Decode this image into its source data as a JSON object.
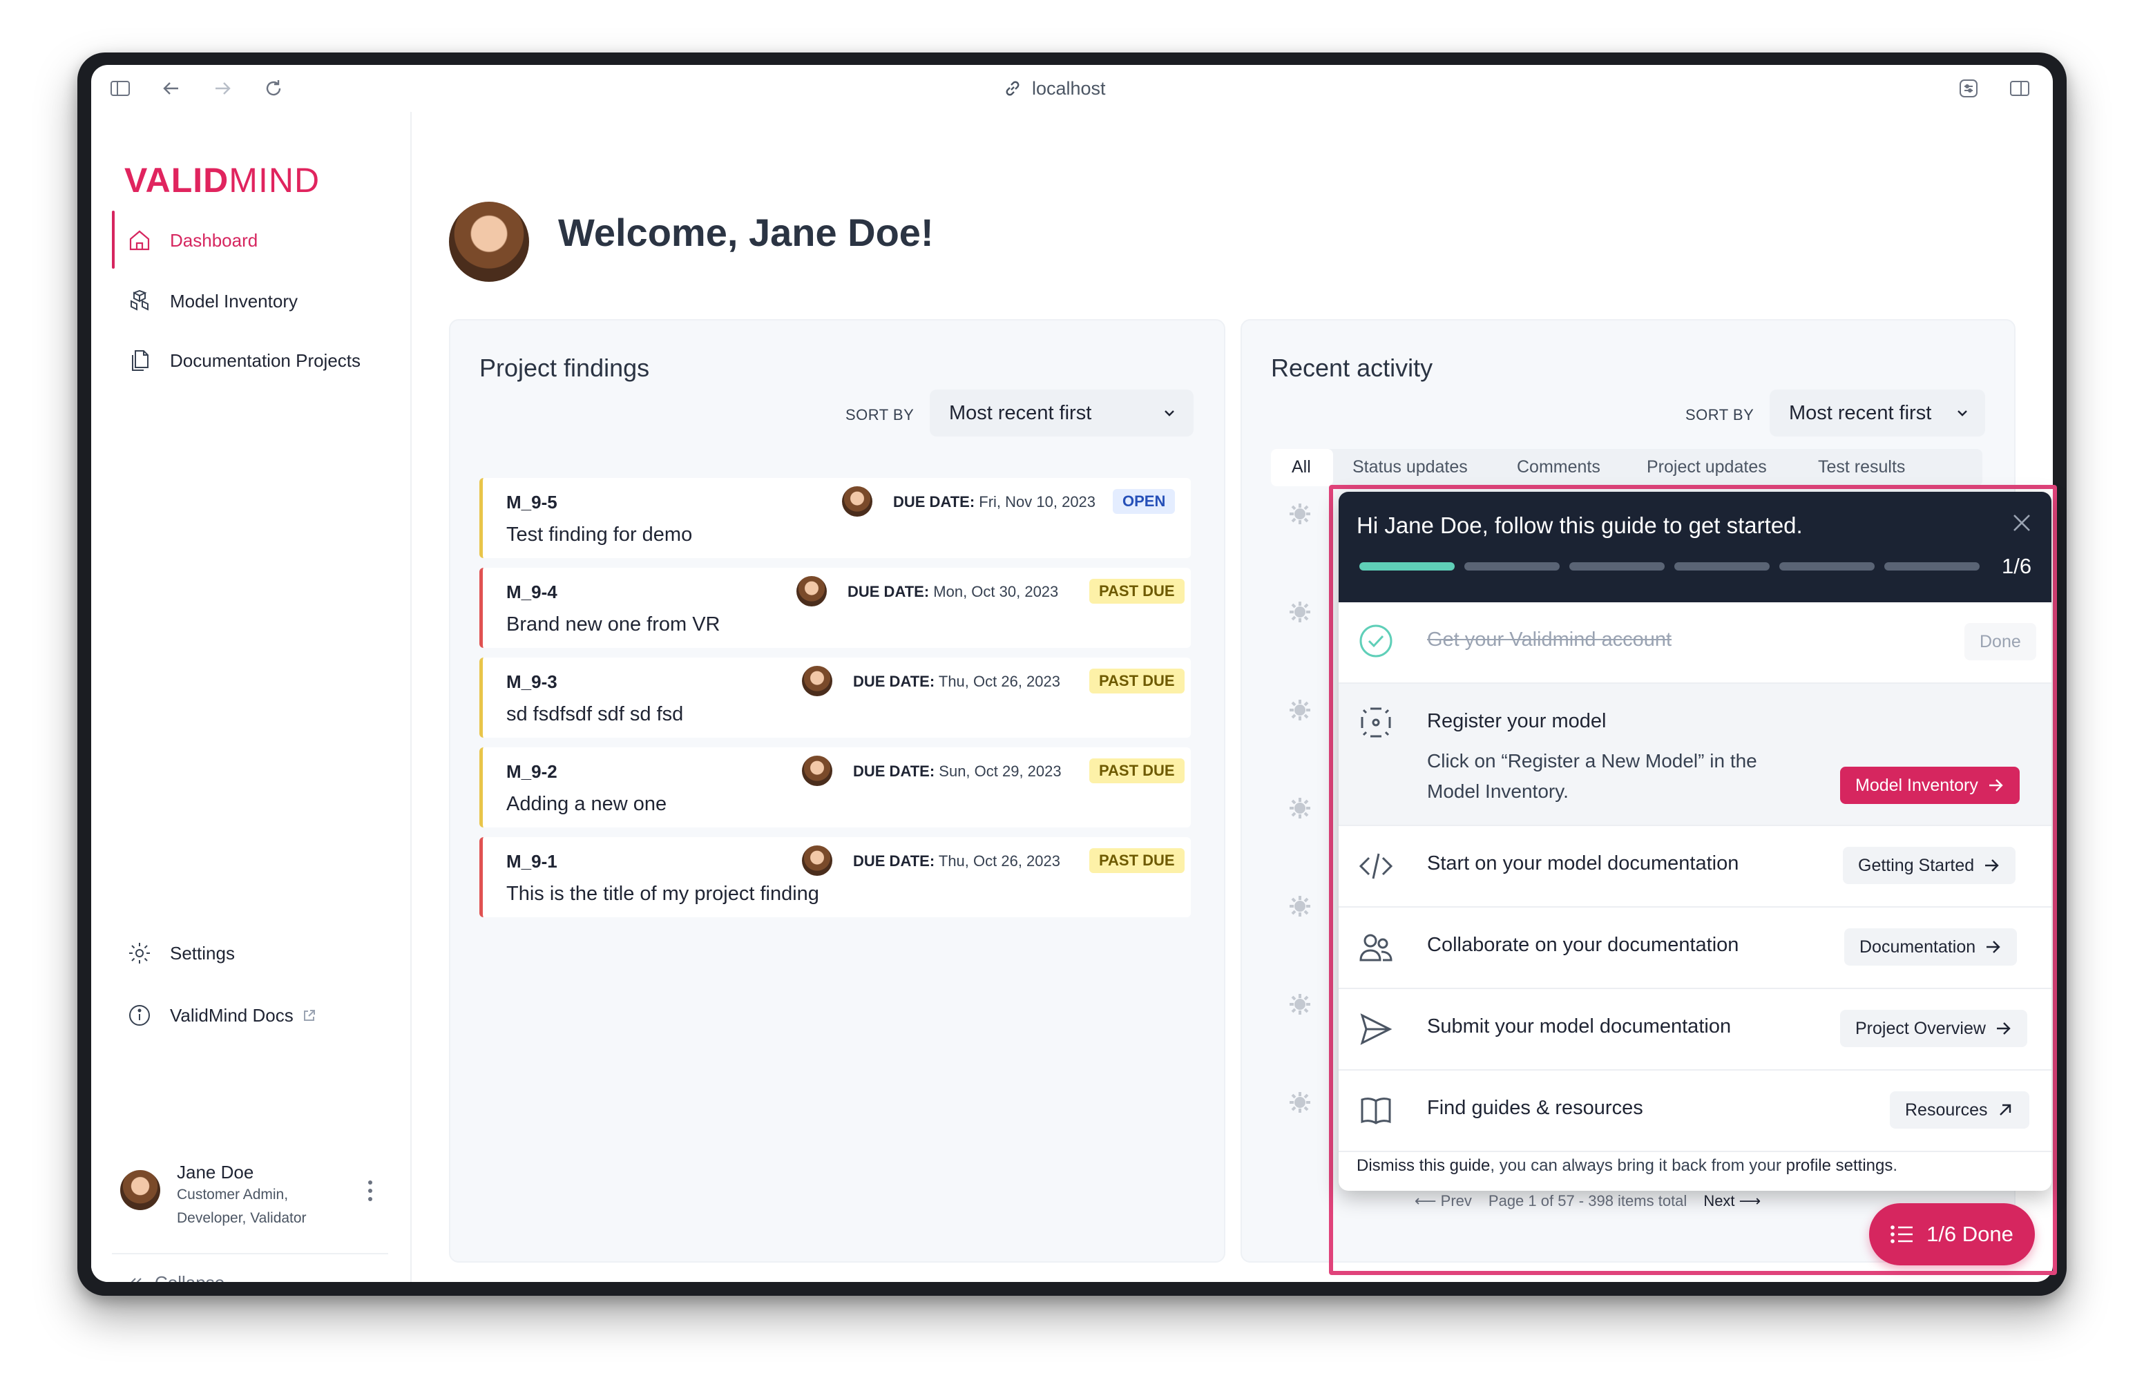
{
  "browser": {
    "url": "localhost"
  },
  "sidebar": {
    "logo": {
      "prefix": "VALID",
      "suffix": "MIND"
    },
    "items": [
      {
        "label": "Dashboard",
        "icon": "home-icon",
        "active": true
      },
      {
        "label": "Model Inventory",
        "icon": "cubes-icon",
        "active": false
      },
      {
        "label": "Documentation Projects",
        "icon": "documents-icon",
        "active": false
      }
    ],
    "bottom_items": [
      {
        "label": "Settings",
        "icon": "gear-icon"
      },
      {
        "label": "ValidMind Docs",
        "icon": "info-icon"
      }
    ],
    "user": {
      "name": "Jane Doe",
      "roles_line1": "Customer Admin,",
      "roles_line2": "Developer, Validator"
    },
    "collapse_label": "Collapse"
  },
  "main": {
    "welcome": "Welcome, Jane Doe!"
  },
  "findings": {
    "title": "Project findings",
    "sort_label": "SORT BY",
    "sort_value": "Most recent first",
    "due_label": "DUE DATE:",
    "items": [
      {
        "id": "M_9-5",
        "title": "Test finding for demo",
        "due": "Fri, Nov 10, 2023",
        "status": "OPEN",
        "accent": "#e9c54a"
      },
      {
        "id": "M_9-4",
        "title": "Brand new one from VR",
        "due": "Mon, Oct 30, 2023",
        "status": "PAST DUE",
        "accent": "#e05252"
      },
      {
        "id": "M_9-3",
        "title": "sd fsdfsdf sdf sd fsd",
        "due": "Thu, Oct 26, 2023",
        "status": "PAST DUE",
        "accent": "#e9c54a"
      },
      {
        "id": "M_9-2",
        "title": "Adding a new one",
        "due": "Sun, Oct 29, 2023",
        "status": "PAST DUE",
        "accent": "#e9c54a"
      },
      {
        "id": "M_9-1",
        "title": "This is the title of my project finding",
        "due": "Thu, Oct 26, 2023",
        "status": "PAST DUE",
        "accent": "#e05252"
      }
    ]
  },
  "activity": {
    "title": "Recent activity",
    "sort_label": "SORT BY",
    "sort_value": "Most recent first",
    "tabs": [
      "All",
      "Status updates",
      "Comments",
      "Project updates",
      "Test results"
    ],
    "pager": {
      "prev": "Prev",
      "info": "Page 1 of 57 - 398 items total",
      "next": "Next"
    }
  },
  "guide": {
    "title": "Hi Jane Doe, follow this guide to get started.",
    "progress": {
      "done": 1,
      "total": 6,
      "label": "1/6"
    },
    "steps": [
      {
        "label": "Get your Validmind account",
        "icon": "check-circle-icon",
        "button": "Done",
        "completed": true
      },
      {
        "label": "Register your model",
        "description": "Click on “Register a New Model” in the Model Inventory.",
        "icon": "focus-icon",
        "button": "Model Inventory"
      },
      {
        "label": "Start on your model documentation",
        "icon": "code-icon",
        "button": "Getting Started"
      },
      {
        "label": "Collaborate on your documentation",
        "icon": "users-icon",
        "button": "Documentation"
      },
      {
        "label": "Submit your model documentation",
        "icon": "send-icon",
        "button": "Project Overview"
      },
      {
        "label": "Find guides & resources",
        "icon": "book-icon",
        "button": "Resources"
      }
    ],
    "footer": {
      "dismiss": "Dismiss this guide",
      "middle": ", you can always bring it back from your ",
      "link": "profile settings",
      "end": "."
    },
    "done_button": "1/6 Done"
  },
  "colors": {
    "brand": "#d6265f",
    "guide_header": "#1b2333",
    "progress_done": "#5fcfb8"
  }
}
